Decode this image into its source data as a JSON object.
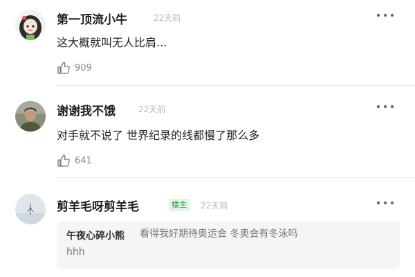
{
  "comments": [
    {
      "user": "第一顶流小牛",
      "time": "22天前",
      "text": "这大概就叫无人比肩...",
      "likes": "909",
      "avatar_icon": "cartoon-girl-avatar"
    },
    {
      "user": "谢谢我不饿",
      "time": "22天前",
      "text": "对手就不说了 世界纪录的线都慢了那么多",
      "likes": "641",
      "avatar_icon": "photo-person-avatar"
    },
    {
      "user": "剪羊毛呀剪羊毛",
      "badge": "楼主",
      "time": "22天前",
      "avatar_icon": "landscape-avatar",
      "reply": {
        "user": "午夜心碎小熊",
        "text_line1": "看得我好期待奥运会 冬奥会有冬泳吗",
        "text_line2": "hhh"
      }
    }
  ],
  "icons": {
    "more": "more-dots-icon",
    "like": "thumbs-up-icon"
  },
  "colors": {
    "badge_text": "#20a049",
    "badge_bg": "#e3f5e6",
    "muted": "#b9b9b9"
  }
}
